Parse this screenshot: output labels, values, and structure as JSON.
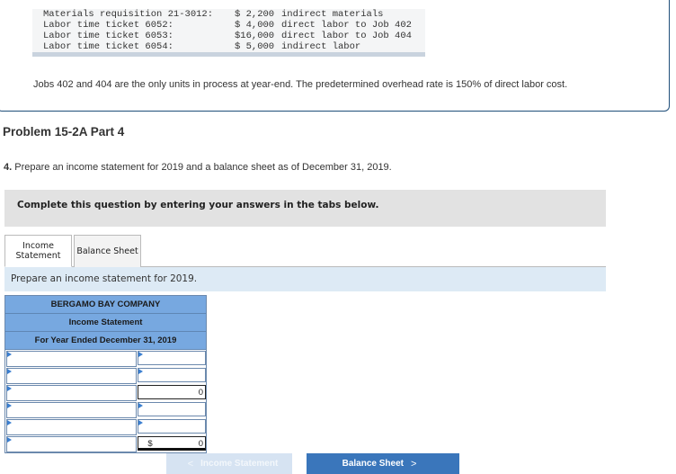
{
  "problem": {
    "transactions": [
      {
        "label": "Materials requisition 21-3012:",
        "amount": "$ 2,200",
        "description": "indirect materials"
      },
      {
        "label": "Labor time ticket 6052:",
        "amount": "$ 4,000",
        "description": "direct labor to Job 402"
      },
      {
        "label": "Labor time ticket 6053:",
        "amount": "$16,000",
        "description": "direct labor to Job 404"
      },
      {
        "label": "Labor time ticket 6054:",
        "amount": "$ 5,000",
        "description": "indirect labor"
      }
    ],
    "note": "Jobs 402 and 404 are the only units in process at year-end. The predetermined overhead rate is 150% of direct labor cost."
  },
  "part_title": "Problem 15-2A Part 4",
  "instruction": {
    "number": "4.",
    "text": " Prepare an income statement for 2019 and a balance sheet as of December 31, 2019."
  },
  "complete_banner": "Complete this question by entering your answers in the tabs below.",
  "tabs": [
    {
      "label": "Income Statement",
      "active": true
    },
    {
      "label": "Balance Sheet",
      "active": false
    }
  ],
  "tab_description": "Prepare an income statement for 2019.",
  "statement": {
    "company": "BERGAMO BAY COMPANY",
    "title": "Income Statement",
    "period": "For Year Ended December 31, 2019",
    "rows": [
      {
        "label": "",
        "prefix": "",
        "value": ""
      },
      {
        "label": "",
        "prefix": "",
        "value": ""
      },
      {
        "label": "",
        "prefix": "",
        "value": "0"
      },
      {
        "label": "",
        "prefix": "",
        "value": ""
      },
      {
        "label": "",
        "prefix": "",
        "value": ""
      },
      {
        "label": "",
        "prefix": "$",
        "value": "0"
      }
    ]
  },
  "nav": {
    "prev_label": "Income Statement",
    "next_label": "Balance Sheet"
  }
}
